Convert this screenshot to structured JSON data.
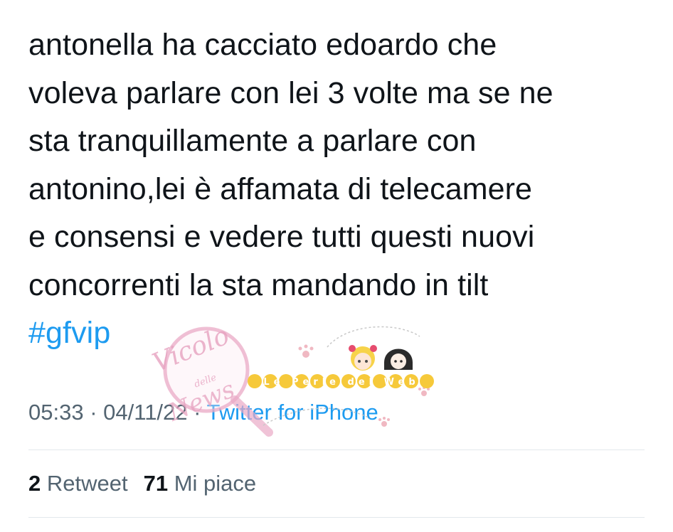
{
  "tweet": {
    "lines": [
      "antonella ha cacciato edoardo che",
      "voleva parlare con lei 3 volte ma se ne",
      "sta tranquillamente a parlare con",
      "antonino,lei è affamata di telecamere",
      "e consensi e vedere tutti questi nuovi",
      "concorrenti la sta mandando in tilt"
    ],
    "hashtag": "#gfvip",
    "time": "05:33",
    "separator": "·",
    "date": "04/11/22",
    "source": "Twitter for iPhone"
  },
  "stats": {
    "retweets_count": "2",
    "retweets_label": "Retweet",
    "likes_count": "71",
    "likes_label": "Mi piace"
  },
  "watermarks": {
    "vicolo_top": "Vicolo",
    "vicolo_mid": "delle",
    "vicolo_bottom": "News",
    "perle": "Le Perle del Web"
  },
  "colors": {
    "text": "#0f1419",
    "secondary": "#536471",
    "link": "#1d9bf0",
    "divider": "#e3e8ec",
    "watermark_pink": "#e8a5c3",
    "watermark_yellow": "#f2c230"
  }
}
